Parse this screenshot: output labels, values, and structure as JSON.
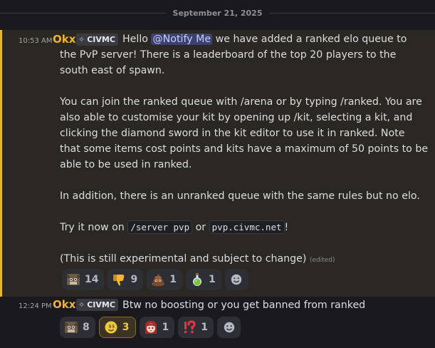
{
  "divider": {
    "date": "September 21, 2025"
  },
  "message1": {
    "timestamp": "10:53 AM",
    "author": "Okx",
    "tag": "CIVMC",
    "p1": {
      "l1_a": "Hello ",
      "mention": "@Notify Me",
      "l1_b": " we have added a ranked elo queue to",
      "l2": "the PvP server! There is a leaderboard of the top 20 players to the",
      "l3": "south east of spawn."
    },
    "p2": [
      "You can join the ranked queue with /arena or by typing /ranked. You are",
      "also able to customise your kit by opening up /kit, selecting a kit, and",
      "clicking the diamond sword in the kit editor to use it in ranked. Note",
      "that some items cost points and kits have a maximum of 50 points to be",
      "able to be used in ranked."
    ],
    "p3": "In addition, there is an unranked queue with the same rules but no elo.",
    "p4": {
      "a": "Try it now on ",
      "code1": "/server pvp",
      "b": " or ",
      "code2": "pvp.civmc.net",
      "c": "!"
    },
    "p5": "(This is still experimental and subject to change)",
    "edited": "(edited)",
    "reactions": [
      {
        "emoji": "cat-emoji",
        "count": "14"
      },
      {
        "emoji": "thumbs-down-emoji",
        "count": "9"
      },
      {
        "emoji": "poop-emoji",
        "count": "1"
      },
      {
        "emoji": "potion-emoji",
        "count": "1"
      }
    ]
  },
  "message2": {
    "timestamp": "12:24 PM",
    "author": "Okx",
    "tag": "CIVMC",
    "text": "Btw no boosting or you get banned from ranked",
    "reactions": [
      {
        "emoji": "cat-emoji",
        "count": "8"
      },
      {
        "emoji": "money-face-emoji",
        "count": "3"
      },
      {
        "emoji": "anime-girl-emoji",
        "count": "1"
      },
      {
        "emoji": "interrobang-emoji",
        "count": "1"
      }
    ]
  },
  "colors": {
    "accent": "#f0b232",
    "mention_bg": "#3c4270",
    "highlight_bg": "#2b2722"
  }
}
